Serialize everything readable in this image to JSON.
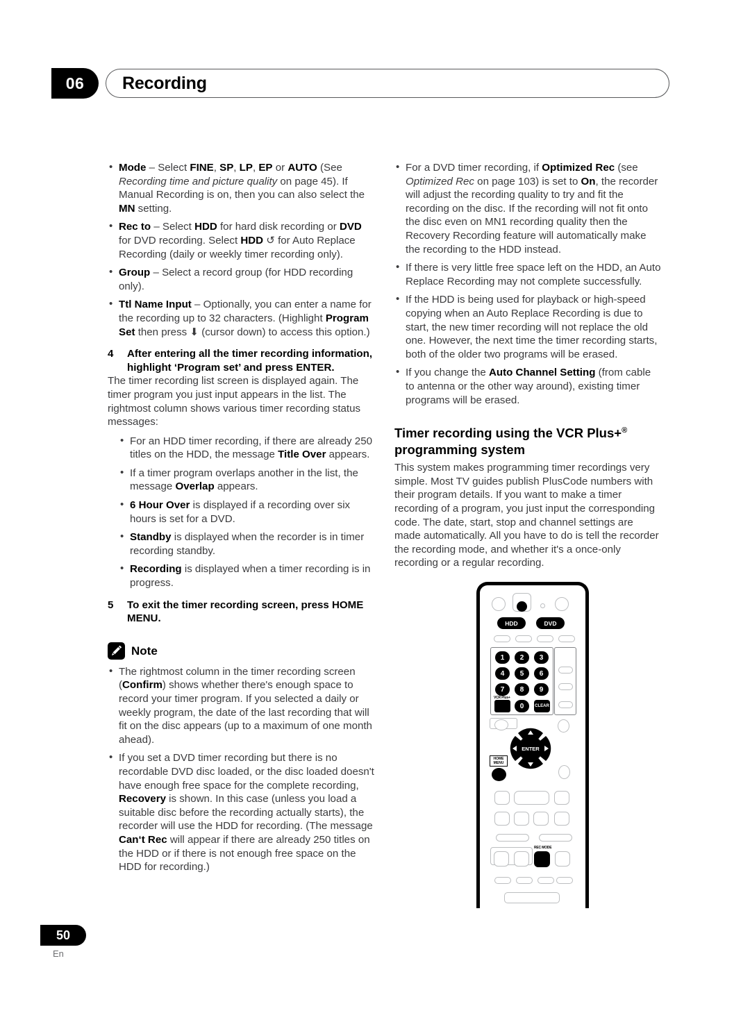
{
  "header": {
    "chapter_number": "06",
    "title": "Recording"
  },
  "footer": {
    "page_number": "50",
    "language": "En"
  },
  "left_column": {
    "bullets_top": [
      {
        "id": "mode",
        "html": "<b>Mode</b> – Select <b>FINE</b>, <b>SP</b>, <b>LP</b>, <b>EP</b> or <b>AUTO</b> (See <i>Recording time and picture quality</i> on page 45). If Manual Recording is on, then you can also select the <b>MN</b> setting."
      },
      {
        "id": "rec-to",
        "html": "<b>Rec to</b> – Select <b>HDD</b> for hard disk recording or <b>DVD</b> for DVD recording. Select <b>HDD</b> ↺ for Auto Replace Recording (daily or weekly timer recording only)."
      },
      {
        "id": "group",
        "html": "<b>Group</b> – Select a record group (for HDD recording only)."
      },
      {
        "id": "ttl-name-input",
        "html": "<b>Ttl Name Input</b> – Optionally, you can enter a name for the recording up to 32 characters. (Highlight <b>Program Set</b> then press ⬇ (cursor down) to access this option.)"
      }
    ],
    "step4": {
      "number": "4",
      "heading": "After entering all the timer recording information, highlight ‘Program set’ and press ENTER.",
      "body": "The timer recording list screen is displayed again. The timer program you just input appears in the list. The rightmost column shows various timer recording status messages:"
    },
    "status_bullets": [
      {
        "id": "title-over",
        "html": "For an HDD timer recording, if there are already 250 titles on the HDD, the message <b>Title Over</b> appears."
      },
      {
        "id": "overlap",
        "html": "If a timer program overlaps another in the list, the message <b>Overlap</b> appears."
      },
      {
        "id": "six-hour-over",
        "html": "<b>6 Hour Over</b> is displayed if a recording over six hours is set for a DVD."
      },
      {
        "id": "standby",
        "html": "<b>Standby</b> is displayed when the recorder is in timer recording standby."
      },
      {
        "id": "recording",
        "html": "<b>Recording</b> is displayed when a timer recording is in progress."
      }
    ],
    "step5": {
      "number": "5",
      "heading": "To exit the timer recording screen, press HOME MENU."
    },
    "note": {
      "label": "Note",
      "icon": "pencil-icon",
      "bullets": [
        {
          "id": "confirm-column",
          "html": "The rightmost column in the timer recording screen (<b>Confirm</b>) shows whether there's enough space to record your timer program. If you selected a daily or weekly program, the date of the last recording that will fit on the disc appears (up to a maximum of one month ahead)."
        },
        {
          "id": "recovery",
          "html": "If you set a DVD timer recording but there is no recordable DVD disc loaded, or the disc loaded doesn't have enough free space for the complete recording, <b>Recovery</b> is shown. In this case (unless you load a suitable disc before the recording actually starts), the recorder will use the HDD for recording. (The message <b>Can‘t Rec</b> will appear if there are already 250 titles on the HDD or if there is not enough free space on the HDD for recording.)"
        }
      ]
    }
  },
  "right_column": {
    "bullets_top": [
      {
        "id": "optimized-rec",
        "html": "For a DVD timer recording, if <b>Optimized Rec</b> (see <i>Optimized Rec</i> on page 103) is set to <b>On</b>, the recorder will adjust the recording quality to try and fit the recording on the disc. If the recording will not fit onto the disc even on MN1 recording quality then the Recovery Recording feature will automatically make the recording to the HDD instead."
      },
      {
        "id": "little-free-space",
        "html": "If there is very little free space left on the HDD, an Auto Replace Recording may not complete successfully."
      },
      {
        "id": "hdd-in-use",
        "html": "If the HDD is being used for playback or high-speed copying when an Auto Replace Recording is due to start, the new timer recording will not replace the old one. However, the next time the timer recording starts, both of the older two programs will be erased."
      },
      {
        "id": "auto-channel-setting",
        "html": "If you change the <b>Auto Channel Setting</b> (from cable to antenna or the other way around), existing timer programs will be erased."
      }
    ],
    "section": {
      "heading_line1": "Timer recording using the VCR Plus+",
      "heading_sup": "®",
      "heading_line2": "programming system",
      "body": "This system makes programming timer recordings very simple. Most TV guides publish PlusCode numbers with their program details. If you want to make a timer recording of a program, you just input the corresponding code. The date, start, stop and channel settings are made automatically. All you have to do is tell the recorder the recording mode, and whether it's a once-only recording or a regular recording."
    }
  },
  "remote": {
    "source_select": [
      {
        "id": "hdd",
        "label": "HDD"
      },
      {
        "id": "dvd",
        "label": "DVD"
      }
    ],
    "keypad": [
      [
        "1",
        "2",
        "3"
      ],
      [
        "4",
        "5",
        "6"
      ],
      [
        "7",
        "8",
        "9"
      ]
    ],
    "keypad_bottom": {
      "vcr_plus_label": "VCR Plus+",
      "zero": "0",
      "clear": "CLEAR"
    },
    "enter_label": "ENTER",
    "home_menu_label_line1": "HOME",
    "home_menu_label_line2": "MENU",
    "rec_mode_label": "REC MODE"
  }
}
